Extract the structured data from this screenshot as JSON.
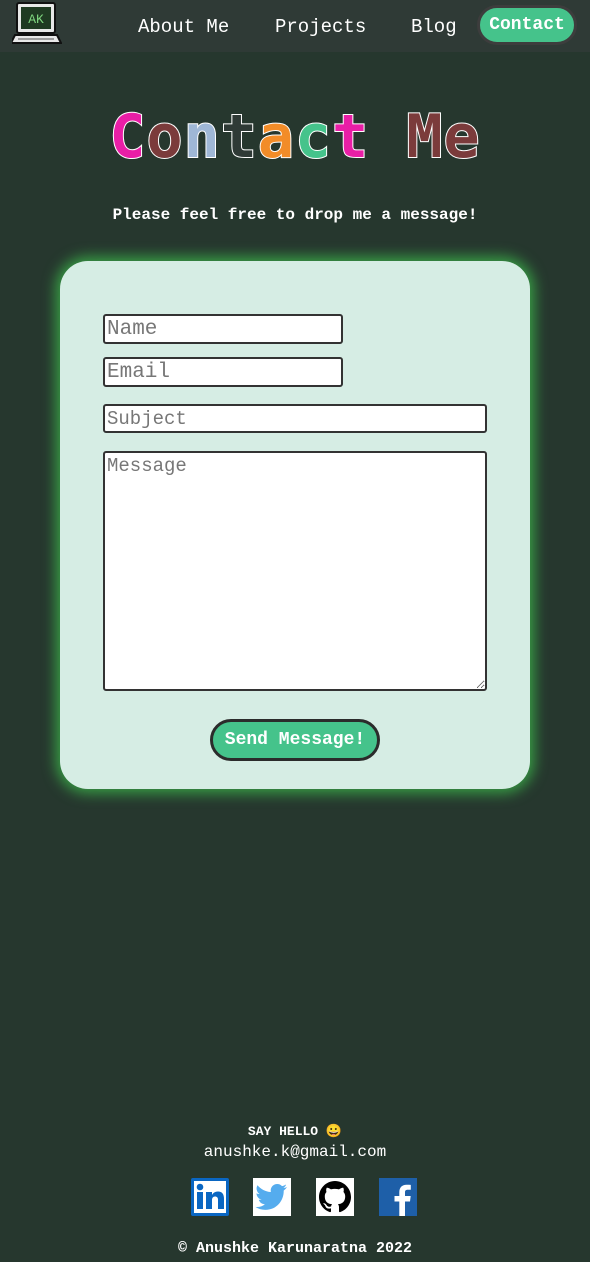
{
  "nav": {
    "logo_text": "AK",
    "links": [
      {
        "label": "About Me"
      },
      {
        "label": "Projects"
      },
      {
        "label": "Blog"
      },
      {
        "label": "Contact"
      }
    ],
    "accent": "#45c38b"
  },
  "hero": {
    "title_letters": [
      "C",
      "o",
      "n",
      "t",
      "a",
      "c",
      "t",
      " ",
      "M",
      "e"
    ],
    "letter_colors": [
      "#e91ea6",
      "#7b3b3b",
      "#9fb7d6",
      "#2f3a36",
      "#f28c28",
      "#45c38b",
      "#e91ea6",
      "#000000",
      "#7b3b3b",
      "#7b3b3b"
    ],
    "subtitle": "Please feel free to drop me a message!"
  },
  "form": {
    "name_placeholder": "Name",
    "email_placeholder": "Email",
    "subject_placeholder": "Subject",
    "message_placeholder": "Message",
    "send_label": "Send Message!"
  },
  "footer": {
    "say_hello": "SAY HELLO 😀",
    "email": "anushke.k@gmail.com",
    "socials": [
      "linkedin-icon",
      "twitter-icon",
      "github-icon",
      "facebook-icon"
    ],
    "copyright": "© Anushke Karunaratna 2022"
  },
  "colors": {
    "background": "#26372e",
    "card": "#d6ede4",
    "glow": "#39a246"
  }
}
